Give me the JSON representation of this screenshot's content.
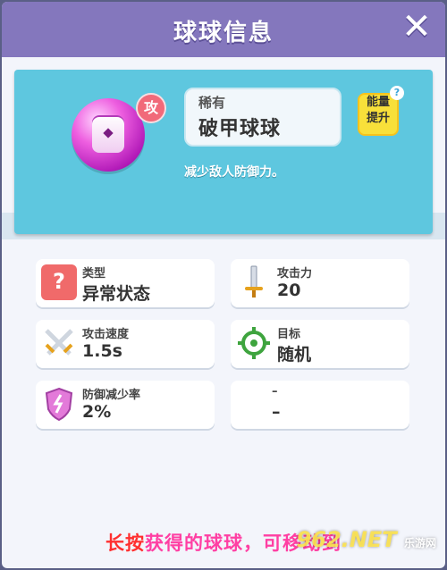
{
  "header": {
    "title": "球球信息",
    "close_icon": "close-icon"
  },
  "hero": {
    "rarity": "稀有",
    "name": "破甲球球",
    "attack_badge": "攻",
    "energy_label_1": "能量",
    "energy_label_2": "提升",
    "energy_help": "?",
    "description": "减少敌人防御力。"
  },
  "stats": [
    {
      "label": "类型",
      "value": "异常状态",
      "icon": "question-icon"
    },
    {
      "label": "攻击力",
      "value": "20",
      "icon": "sword-icon"
    },
    {
      "label": "攻击速度",
      "value": "1.5s",
      "icon": "crossed-swords-icon"
    },
    {
      "label": "目标",
      "value": "随机",
      "icon": "target-icon"
    },
    {
      "label": "防御减少率",
      "value": "2%",
      "icon": "broken-shield-icon"
    },
    {
      "label": "–",
      "value": "–",
      "icon": ""
    }
  ],
  "footer": {
    "hold": "长按",
    "rest": "获得的球球，可移动到"
  },
  "watermark": {
    "brand": "962.NET",
    "sub": "乐游网"
  },
  "colors": {
    "header": "#8477bd",
    "hero": "#5ec7df",
    "energy": "#f8e03a",
    "footer_text": "#ff3fa3",
    "hold_text": "#ff2f2f"
  }
}
